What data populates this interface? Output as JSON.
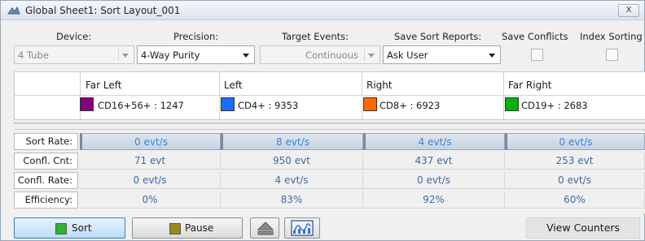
{
  "window": {
    "title": "Global Sheet1: Sort Layout_001",
    "close_label": "X"
  },
  "settings": {
    "device_label": "Device:",
    "device_value": "4 Tube",
    "precision_label": "Precision:",
    "precision_value": "4-Way Purity",
    "target_events_label": "Target Events:",
    "target_events_value": "Continuous",
    "save_sort_reports_label": "Save Sort Reports:",
    "save_sort_reports_value": "Ask User",
    "save_conflicts_label": "Save Conflicts",
    "save_conflicts_checked": false,
    "index_sorting_label": "Index Sorting",
    "index_sorting_checked": false
  },
  "targets": [
    {
      "name": "Far Left",
      "gate": "CD16+56+ : 1247",
      "color": "#800080"
    },
    {
      "name": "Left",
      "gate": "CD4+ : 9353",
      "color": "#1a6cff"
    },
    {
      "name": "Right",
      "gate": "CD8+ : 6923",
      "color": "#ff6a00"
    },
    {
      "name": "Far Right",
      "gate": "CD19+ : 2683",
      "color": "#00b400"
    }
  ],
  "stats": {
    "labels": {
      "sort_rate": "Sort Rate:",
      "confl_cnt": "Confl. Cnt:",
      "confl_rate": "Confl. Rate:",
      "efficiency": "Efficiency:"
    },
    "sort_rate": [
      "0 evt/s",
      "8 evt/s",
      "4 evt/s",
      "0 evt/s"
    ],
    "confl_cnt": [
      "71 evt",
      "950 evt",
      "437 evt",
      "253 evt"
    ],
    "confl_rate": [
      "0 evt/s",
      "4 evt/s",
      "0 evt/s",
      "0 evt/s"
    ],
    "efficiency": [
      "0%",
      "83%",
      "92%",
      "60%"
    ]
  },
  "toolbar": {
    "sort_label": "Sort",
    "sort_icon_color": "#2fb52f",
    "pause_label": "Pause",
    "pause_icon_color": "#9a8a1a",
    "eject_icon": "eject-icon",
    "calibration_icon": "calibration-icon",
    "view_counters_label": "View Counters"
  }
}
